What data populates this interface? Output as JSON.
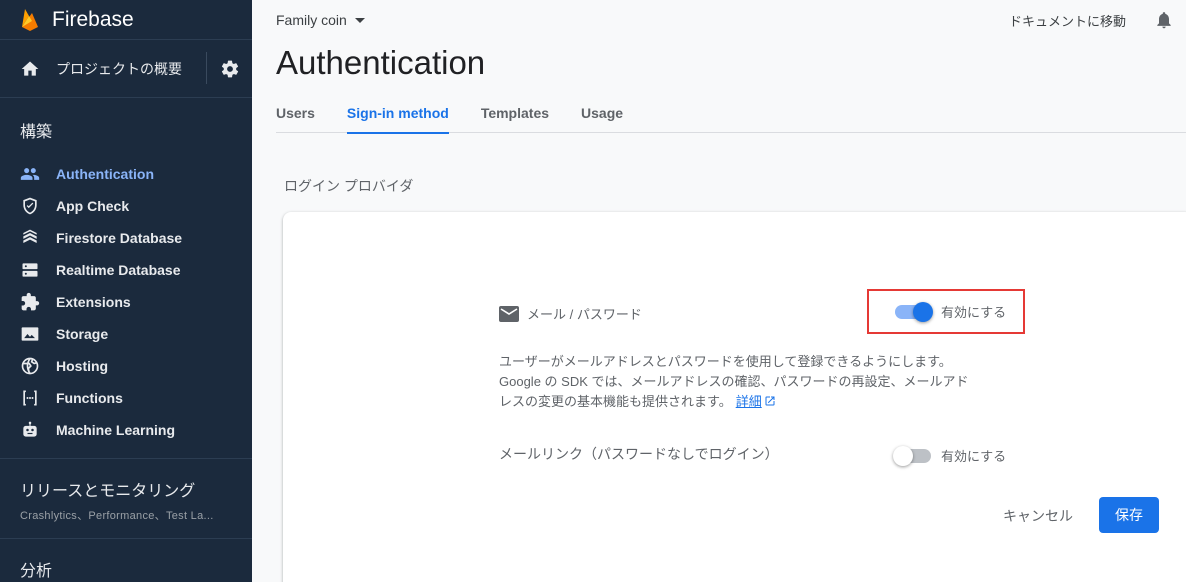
{
  "sidebar": {
    "brand": "Firebase",
    "overview_label": "プロジェクトの概要",
    "section_build": "構築",
    "items": [
      {
        "label": "Authentication",
        "icon": "people-icon",
        "active": true
      },
      {
        "label": "App Check",
        "icon": "shield-check-icon"
      },
      {
        "label": "Firestore Database",
        "icon": "firestore-icon"
      },
      {
        "label": "Realtime Database",
        "icon": "database-icon"
      },
      {
        "label": "Extensions",
        "icon": "puzzle-icon"
      },
      {
        "label": "Storage",
        "icon": "image-icon"
      },
      {
        "label": "Hosting",
        "icon": "globe-icon"
      },
      {
        "label": "Functions",
        "icon": "functions-icon"
      },
      {
        "label": "Machine Learning",
        "icon": "robot-icon"
      }
    ],
    "release_title": "リリースとモニタリング",
    "release_sub": "Crashlytics、Performance、Test La...",
    "analytics_title": "分析"
  },
  "header": {
    "project": "Family coin",
    "docs_link": "ドキュメントに移動",
    "title": "Authentication"
  },
  "tabs": [
    {
      "label": "Users"
    },
    {
      "label": "Sign-in method",
      "active": true
    },
    {
      "label": "Templates"
    },
    {
      "label": "Usage"
    }
  ],
  "providers_label": "ログイン プロバイダ",
  "provider": {
    "name": "メール / パスワード",
    "enable_label": "有効にする",
    "enabled": true,
    "description_1": "ユーザーがメールアドレスとパスワードを使用して登録できるようにします。",
    "description_2": "Google の SDK では、メールアドレスの確認、パスワードの再設定、メールアド",
    "description_3": "レスの変更の基本機能も提供されます。",
    "details_link": "詳細",
    "email_link_label": "メールリンク（パスワードなしでログイン）",
    "email_link_enable_label": "有効にする",
    "email_link_enabled": false
  },
  "actions": {
    "cancel": "キャンセル",
    "save": "保存"
  },
  "colors": {
    "sidebar_bg": "#1b2a3d",
    "accent": "#1a73e8",
    "highlight_box": "#e53935"
  }
}
